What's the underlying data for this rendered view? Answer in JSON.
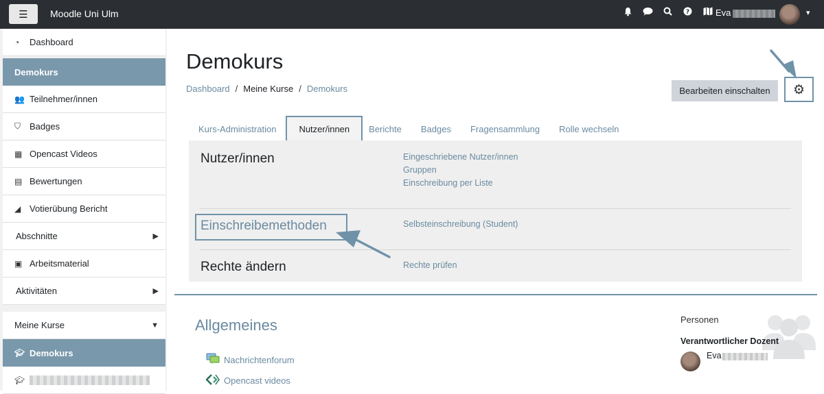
{
  "navbar": {
    "menu_icon": "hamburger-icon",
    "site_name": "Moodle Uni Ulm",
    "icons": [
      "bell-icon",
      "chat-icon",
      "search-icon",
      "help-icon",
      "map-icon"
    ],
    "user_first_name": "Eva"
  },
  "sidebar": {
    "items": [
      {
        "label": "Dashboard",
        "icon": "dashboard-icon"
      },
      {
        "label": "Demokurs"
      },
      {
        "label": "Teilnehmer/innen",
        "icon": "users-icon"
      },
      {
        "label": "Badges",
        "icon": "shield-icon"
      },
      {
        "label": "Opencast Videos",
        "icon": "film-icon"
      },
      {
        "label": "Bewertungen",
        "icon": "table-icon"
      },
      {
        "label": "Votierübung Bericht",
        "icon": "area-chart-icon"
      },
      {
        "label": "Abschnitte"
      },
      {
        "label": "Arbeitsmaterial",
        "icon": "archive-icon"
      },
      {
        "label": "Aktivitäten"
      },
      {
        "label": "Meine Kurse"
      },
      {
        "label": "Demokurs",
        "icon": "graduation-cap-icon"
      },
      {
        "label": "",
        "icon": "graduation-cap-icon"
      }
    ]
  },
  "header": {
    "title": "Demokurs",
    "breadcrumb": [
      "Dashboard",
      "Meine Kurse",
      "Demokurs"
    ],
    "breadcrumb_sep": "/",
    "edit_button": "Bearbeiten einschalten",
    "gear_icon": "gear-icon"
  },
  "tabs": [
    "Kurs-Administration",
    "Nutzer/innen",
    "Berichte",
    "Badges",
    "Fragensammlung",
    "Rolle wechseln"
  ],
  "active_tab": "Nutzer/innen",
  "panel": {
    "rows": [
      {
        "title": "Nutzer/innen",
        "links": [
          "Eingeschriebene Nutzer/innen",
          "Gruppen",
          "Einschreibung per Liste"
        ]
      },
      {
        "title": "Einschreibemethoden",
        "links": [
          "Selbsteinschreibung (Student)"
        ]
      },
      {
        "title": "Rechte ändern",
        "links": [
          "Rechte prüfen"
        ]
      }
    ]
  },
  "course": {
    "section_title": "Allgemeines",
    "activities": [
      {
        "label": "Nachrichtenforum",
        "icon": "forum-icon"
      },
      {
        "label": "Opencast videos",
        "icon": "opencast-icon"
      }
    ]
  },
  "people": {
    "heading": "Personen",
    "role": "Verantwortlicher Dozent",
    "teacher_first_name": "Eva"
  },
  "colors": {
    "navbar": "#2b2f33",
    "accent": "#6f92a8",
    "active_sidebar": "#7a98ab",
    "link": "#6a8aa0"
  }
}
